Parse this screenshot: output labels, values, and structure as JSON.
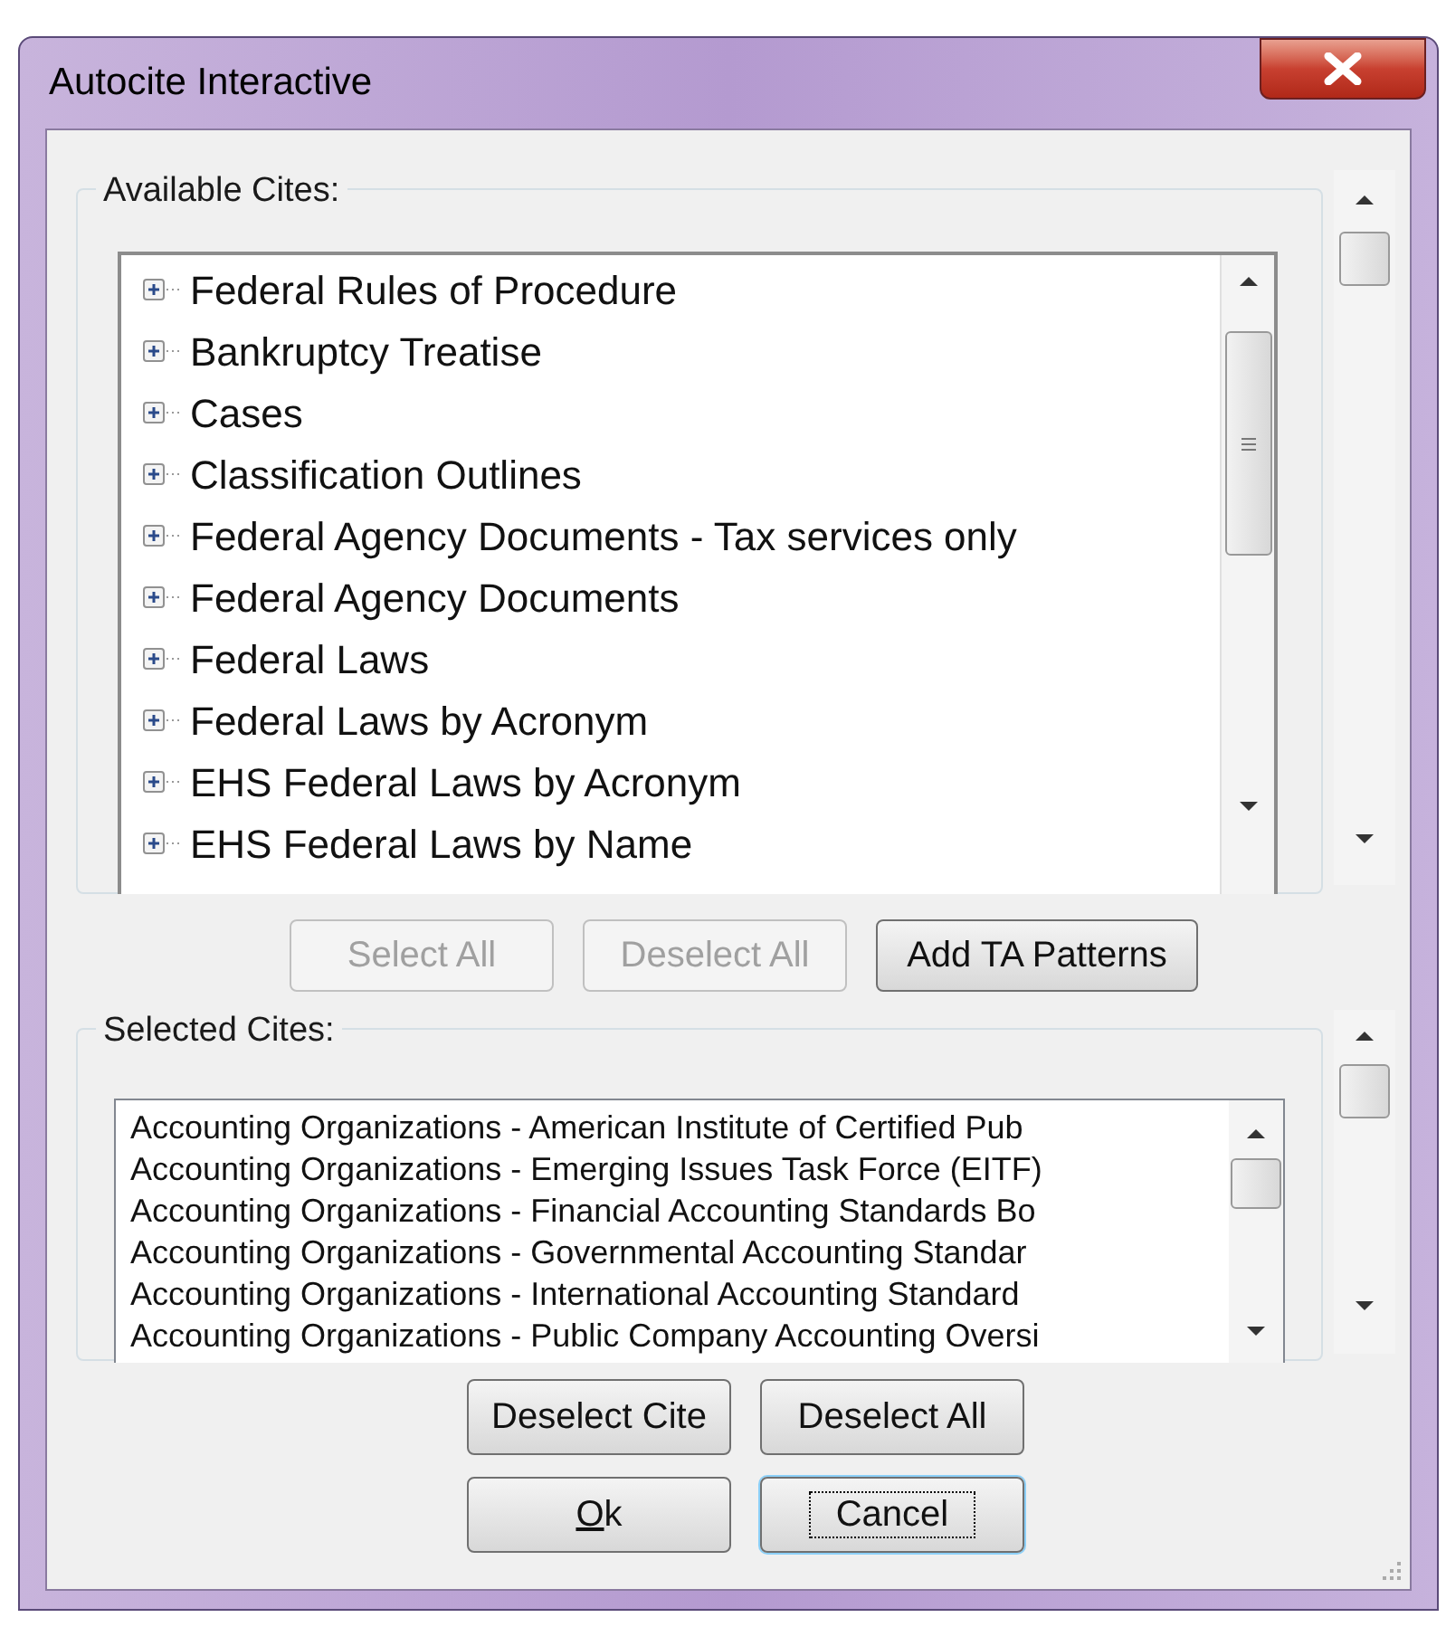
{
  "window": {
    "title": "Autocite Interactive"
  },
  "available_cites": {
    "label": "Available Cites:",
    "items": [
      {
        "label": "Federal Rules of Procedure",
        "expanded": false
      },
      {
        "label": "Bankruptcy Treatise",
        "expanded": false
      },
      {
        "label": "Cases",
        "expanded": false
      },
      {
        "label": "Classification Outlines",
        "expanded": false
      },
      {
        "label": "Federal Agency Documents - Tax services only",
        "expanded": false
      },
      {
        "label": "Federal Agency Documents",
        "expanded": false
      },
      {
        "label": "Federal Laws",
        "expanded": false
      },
      {
        "label": "Federal Laws by Acronym",
        "expanded": false
      },
      {
        "label": "EHS Federal Laws by Acronym",
        "expanded": false
      },
      {
        "label": "EHS Federal Laws by Name",
        "expanded": false
      }
    ]
  },
  "available_buttons": [
    {
      "label": "Select All",
      "disabled": true
    },
    {
      "label": "Deselect All",
      "disabled": true
    },
    {
      "label": "Add TA Patterns",
      "disabled": false
    }
  ],
  "selected_cites": {
    "label": "Selected Cites:",
    "items": [
      "Accounting Organizations - American Institute of Certified Pub",
      "Accounting Organizations - Emerging Issues Task Force (EITF)",
      "Accounting Organizations - Financial Accounting Standards Bo",
      "Accounting Organizations - Governmental Accounting Standar",
      "Accounting Organizations - International Accounting Standard",
      "Accounting Organizations - Public Company Accounting Oversi"
    ]
  },
  "selected_buttons": [
    {
      "label": "Deselect Cite",
      "disabled": false
    },
    {
      "label": "Deselect All",
      "disabled": false
    }
  ],
  "dialog_buttons": [
    {
      "label": "Ok",
      "focused": false,
      "underline_first": true
    },
    {
      "label": "Cancel",
      "focused": true,
      "underline_first": false
    }
  ]
}
